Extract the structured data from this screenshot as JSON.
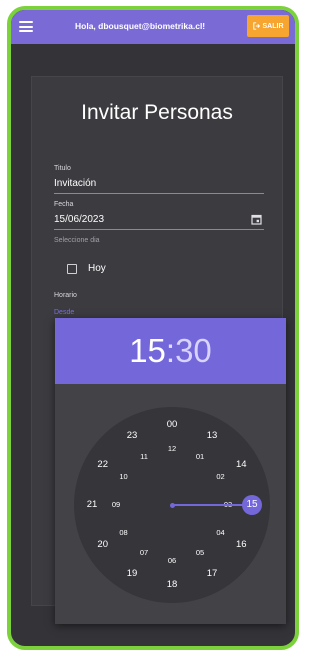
{
  "appbar": {
    "greeting": "Hola, dbousquet@biometrika.cl!",
    "logout_label": "SALIR"
  },
  "form": {
    "title": "Invitar Personas",
    "titulo_label": "Titulo",
    "titulo_value": "Invitación",
    "fecha_label": "Fecha",
    "fecha_value": "15/06/2023",
    "dia_label": "Seleccione dia",
    "hoy_label": "Hoy",
    "horario_label": "Horario",
    "desde_label": "Desde"
  },
  "time_picker": {
    "hour": "15",
    "separator": ":",
    "minute": "30",
    "selected_hour": "15",
    "outer_hours": [
      "00",
      "13",
      "14",
      "15",
      "16",
      "17",
      "18",
      "19",
      "20",
      "21",
      "22",
      "23"
    ],
    "inner_hours": [
      "12",
      "01",
      "02",
      "03",
      "04",
      "05",
      "06",
      "07",
      "08",
      "09",
      "10",
      "11"
    ]
  },
  "colors": {
    "accent": "#7467da",
    "logout": "#f7a531",
    "frame": "#7bd23a",
    "background": "#333338"
  }
}
